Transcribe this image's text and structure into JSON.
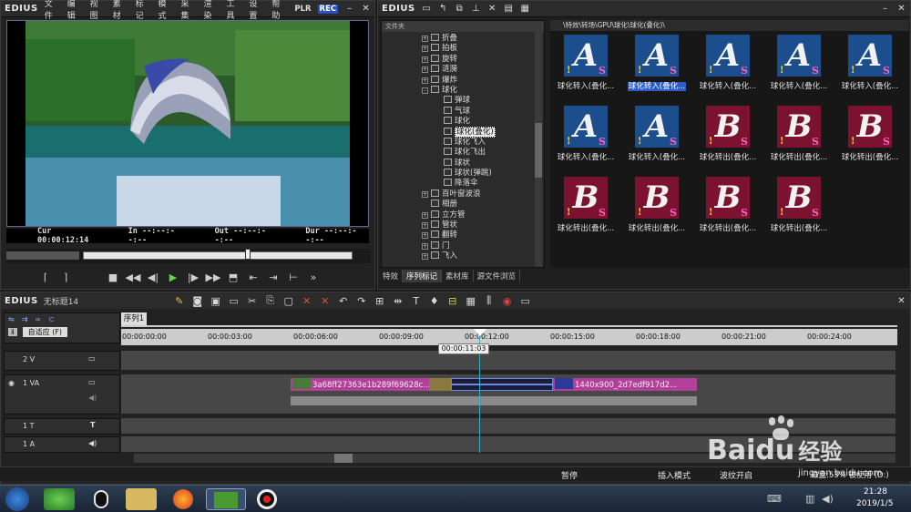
{
  "player": {
    "app": "EDIUS",
    "menu": [
      "文件",
      "编辑",
      "视图",
      "素材",
      "标记",
      "模式",
      "采集",
      "渲染",
      "工具",
      "设置",
      "帮助"
    ],
    "plr": "PLR",
    "rec": "REC",
    "cur_label": "Cur",
    "cur_value": "00:00:12:14",
    "in_label": "In",
    "in_value": "--:--:--:--",
    "out_label": "Out",
    "out_value": "--:--:--:--",
    "dur_label": "Dur",
    "dur_value": "--:--:--:--"
  },
  "bin": {
    "app": "EDIUS",
    "tree_header": "文件夹",
    "tree": [
      {
        "label": "折叠",
        "indent": 1,
        "expand": "+"
      },
      {
        "label": "拍板",
        "indent": 1,
        "expand": "+"
      },
      {
        "label": "旋转",
        "indent": 1,
        "expand": "+"
      },
      {
        "label": "涟漪",
        "indent": 1,
        "expand": "+"
      },
      {
        "label": "爆炸",
        "indent": 1,
        "expand": "+"
      },
      {
        "label": "球化",
        "indent": 1,
        "expand": "-"
      },
      {
        "label": "弹球",
        "indent": 2,
        "expand": ""
      },
      {
        "label": "气球",
        "indent": 2,
        "expand": ""
      },
      {
        "label": "球化",
        "indent": 2,
        "expand": ""
      },
      {
        "label": "球化(叠化)",
        "indent": 2,
        "expand": "",
        "selected": true
      },
      {
        "label": "球化飞入",
        "indent": 2,
        "expand": ""
      },
      {
        "label": "球化飞出",
        "indent": 2,
        "expand": ""
      },
      {
        "label": "球状",
        "indent": 2,
        "expand": ""
      },
      {
        "label": "球状(弹跳)",
        "indent": 2,
        "expand": ""
      },
      {
        "label": "降落伞",
        "indent": 2,
        "expand": ""
      },
      {
        "label": "百叶窗波浪",
        "indent": 1,
        "expand": "+"
      },
      {
        "label": "相册",
        "indent": 1,
        "expand": ""
      },
      {
        "label": "立方管",
        "indent": 1,
        "expand": "+"
      },
      {
        "label": "管状",
        "indent": 1,
        "expand": "+"
      },
      {
        "label": "翻转",
        "indent": 1,
        "expand": "+"
      },
      {
        "label": "门",
        "indent": 1,
        "expand": "+"
      },
      {
        "label": "飞入",
        "indent": 1,
        "expand": "+"
      }
    ],
    "path": "\\特效\\转场\\GPU\\球化\\球化(叠化)\\",
    "thumbs": [
      {
        "label": "球化转入(叠化...",
        "letter": "A",
        "kind": "a"
      },
      {
        "label": "球化转入(叠化...",
        "letter": "A",
        "kind": "a",
        "selected": true
      },
      {
        "label": "球化转入(叠化...",
        "letter": "A",
        "kind": "a"
      },
      {
        "label": "球化转入(叠化...",
        "letter": "A",
        "kind": "a"
      },
      {
        "label": "球化转入(叠化...",
        "letter": "A",
        "kind": "a"
      },
      {
        "label": "球化转入(叠化...",
        "letter": "A",
        "kind": "a"
      },
      {
        "label": "球化转入(叠化...",
        "letter": "A",
        "kind": "a"
      },
      {
        "label": "球化转出(叠化...",
        "letter": "B",
        "kind": "b"
      },
      {
        "label": "球化转出(叠化...",
        "letter": "B",
        "kind": "b"
      },
      {
        "label": "球化转出(叠化...",
        "letter": "B",
        "kind": "b"
      },
      {
        "label": "球化转出(叠化...",
        "letter": "B",
        "kind": "b"
      },
      {
        "label": "球化转出(叠化...",
        "letter": "B",
        "kind": "b"
      },
      {
        "label": "球化转出(叠化...",
        "letter": "B",
        "kind": "b"
      },
      {
        "label": "球化转出(叠化...",
        "letter": "B",
        "kind": "b"
      }
    ],
    "tabs": [
      "特效",
      "序列标记",
      "素材库",
      "源文件浏览"
    ],
    "thumb_badge": "S",
    "thumb_mark": "!"
  },
  "timeline": {
    "app": "EDIUS",
    "project": "无标题14",
    "sequence_tab": "序列1",
    "fit_label": "自适应 (F)",
    "ruler": [
      "00:00:00:00",
      "00:00:03:00",
      "00:00:06:00",
      "00:00:09:00",
      "00:00:12:00",
      "00:00:15:00",
      "00:00:18:00",
      "00:00:21:00",
      "00:00:24:00"
    ],
    "playhead_tc": "00:00:11:03",
    "tracks": {
      "v2": "2 V",
      "va1": "1 VA",
      "t1": "1 T",
      "a1": "1 A"
    },
    "clip1": "3a68ff27363e1b289f69628c...",
    "clip2": "1440x900_2d7edf917d2..."
  },
  "status": {
    "pause": "暂停",
    "insert_mode": "插入模式",
    "ripple": "波纹开启",
    "disk": "磁盘:53% 被使用 (D:)"
  },
  "taskbar": {
    "time": "21:28",
    "date": "2019/1/5"
  },
  "watermark": {
    "brand": "Bai",
    "brand2": "du",
    "jingyan": "经验",
    "url": "jingyan.baidu.com"
  }
}
